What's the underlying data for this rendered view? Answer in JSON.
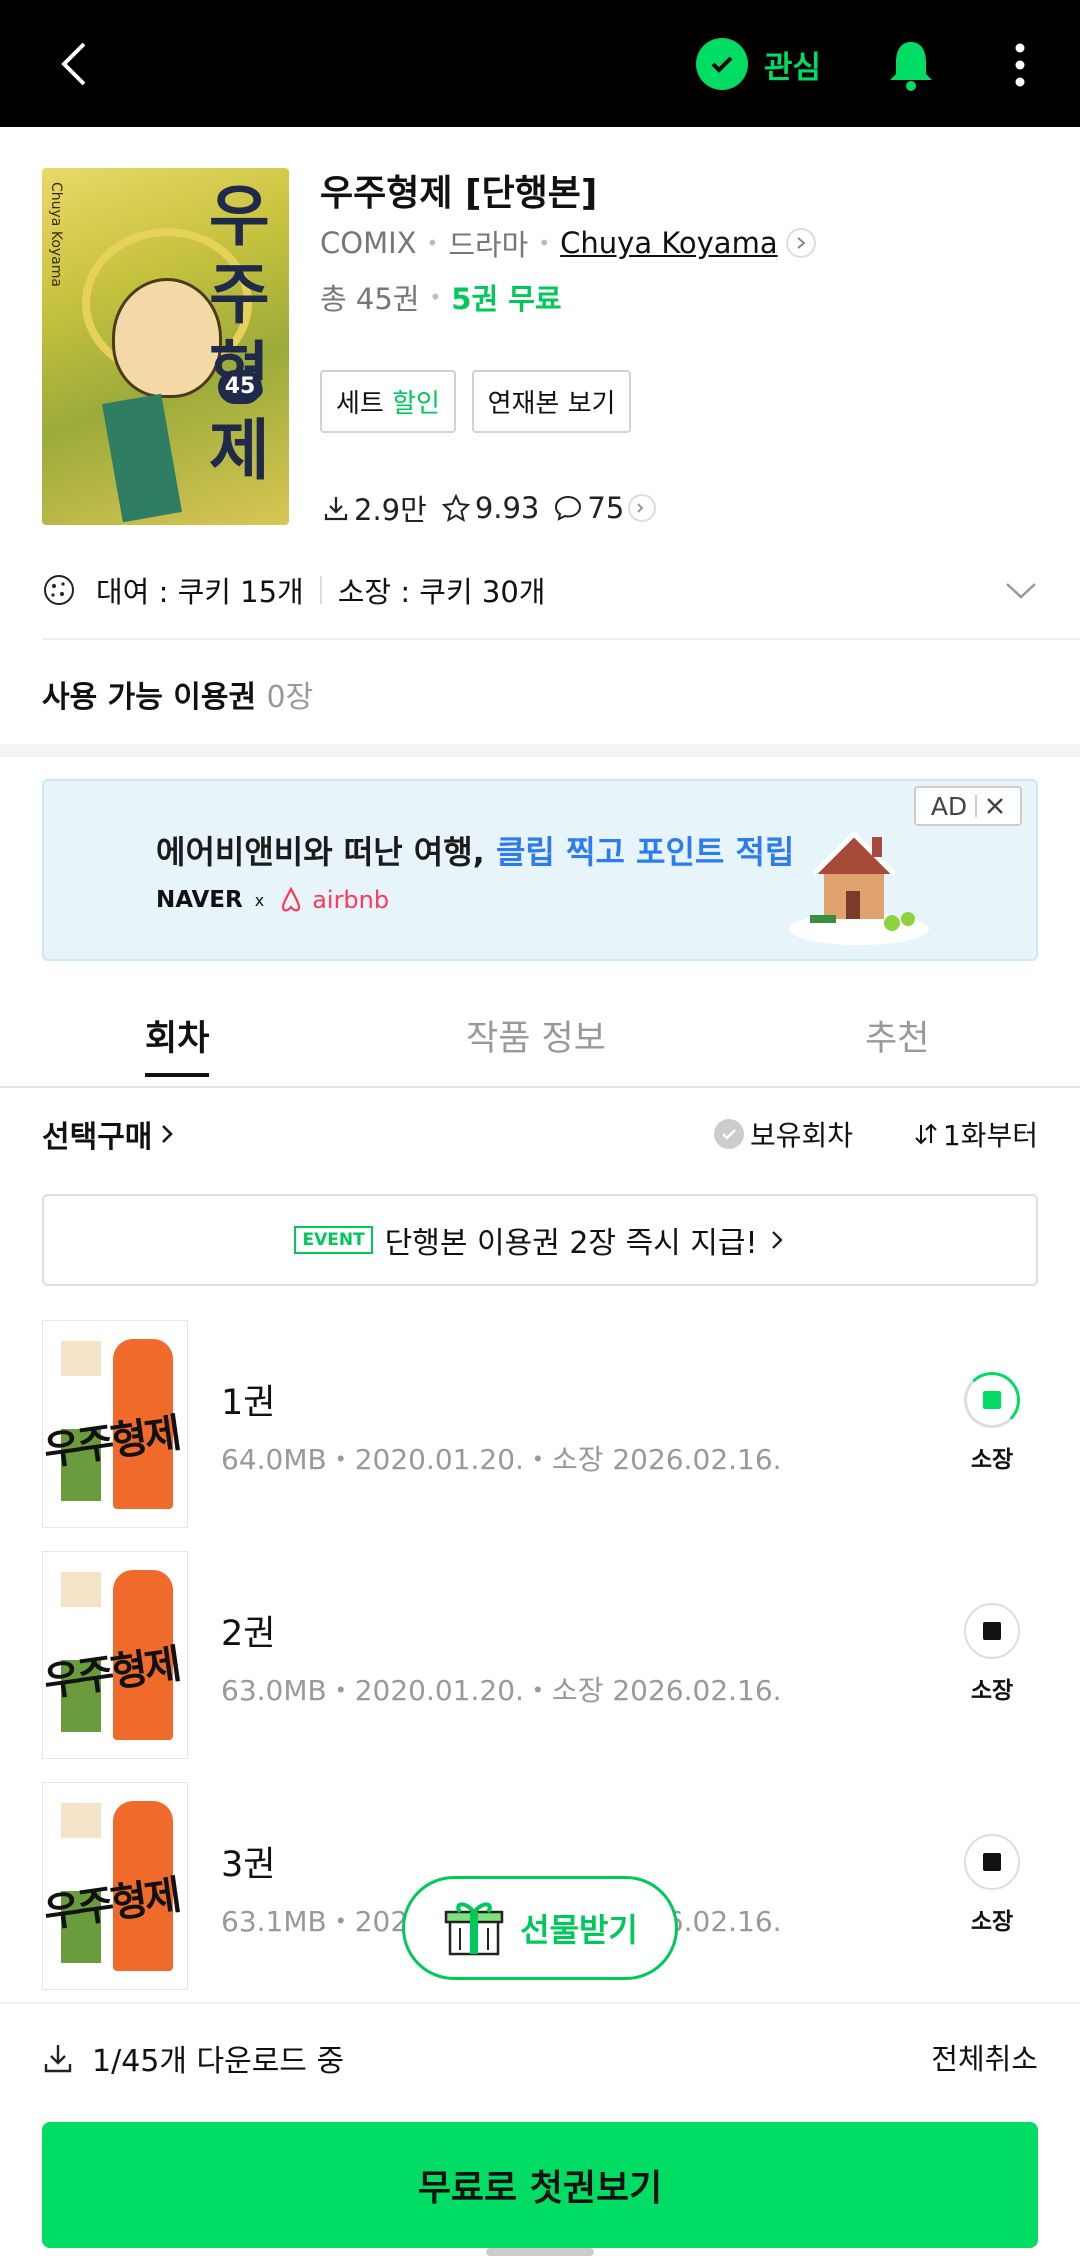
{
  "topbar": {
    "favorite_label": "관심"
  },
  "work": {
    "title": "우주형제 [단행본]",
    "category": "COMIX",
    "genre": "드라마",
    "author": "Chuya Koyama",
    "total_volumes": "총 45권",
    "free_volumes": "5권 무료",
    "cover_title": "우주형제",
    "cover_volume": "45",
    "cover_side_text": "Chuya Koyama"
  },
  "chips": {
    "set_prefix": "세트",
    "set_discount": "할인",
    "serial_label": "연재본 보기"
  },
  "stats": {
    "downloads": "2.9만",
    "rating": "9.93",
    "comments": "75"
  },
  "cookie": {
    "rent": "대여 : 쿠키 15개",
    "own": "소장 : 쿠키 30개"
  },
  "ticket": {
    "label": "사용 가능 이용권",
    "count": "0장"
  },
  "ad": {
    "headline_plain": "에어비앤비와 떠난 여행,",
    "headline_highlight": "클립 찍고 포인트 적립",
    "brand_naver": "NAVER",
    "brand_x": "x",
    "brand_airbnb": "airbnb",
    "badge": "AD"
  },
  "tabs": [
    "회차",
    "작품 정보",
    "추천"
  ],
  "list_controls": {
    "select_buy": "선택구매",
    "owned_filter": "보유회차",
    "sort": "1화부터"
  },
  "event": {
    "tag": "EVENT",
    "text": "단행본 이용권 2장 즉시 지급!"
  },
  "episodes": [
    {
      "name": "1권",
      "info": "64.0MB・2020.01.20.・소장 2026.02.16.",
      "state": "소장",
      "status": "downloading"
    },
    {
      "name": "2권",
      "info": "63.0MB・2020.01.20.・소장 2026.02.16.",
      "state": "소장",
      "status": "queued"
    },
    {
      "name": "3권",
      "info": "63.1MB・2020.01.20.・소장 2026.02.16.",
      "state": "소장",
      "status": "queued"
    }
  ],
  "gift": {
    "label": "선물받기"
  },
  "download_bar": {
    "status": "1/45개 다운로드 중",
    "cancel": "전체취소"
  },
  "cta": {
    "label": "무료로 첫권보기"
  },
  "colors": {
    "accent": "#00dc64",
    "accent_text": "#00c85a",
    "ad_highlight": "#2d7bf0",
    "airbnb": "#ff385c"
  }
}
